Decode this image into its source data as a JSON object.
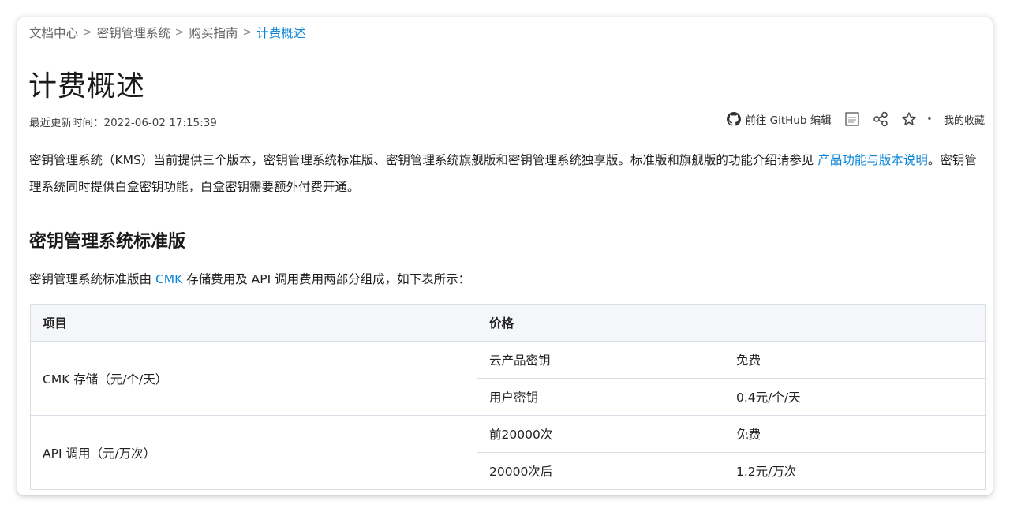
{
  "breadcrumb": {
    "items": [
      "文档中心",
      "密钥管理系统",
      "购买指南"
    ],
    "current": "计费概述",
    "separator": ">"
  },
  "page": {
    "title": "计费概述",
    "updated": "最近更新时间：2022-06-02 17:15:39"
  },
  "toolbar": {
    "github_label": "前往 GitHub 编辑",
    "pdf_icon": "pdf-icon",
    "share_icon": "share-icon",
    "star_icon": "star-icon",
    "dot": "•",
    "favorites_label": "我的收藏"
  },
  "intro": {
    "text1": "密钥管理系统（KMS）当前提供三个版本，密钥管理系统标准版、密钥管理系统旗舰版和密钥管理系统独享版。标准版和旗舰版的功能介绍请参见 ",
    "link": "产品功能与版本说明",
    "text2": "。密钥管理系统同时提供白盒密钥功能，白盒密钥需要额外付费开通。"
  },
  "section": {
    "heading": "密钥管理系统标准版",
    "desc_pre": "密钥管理系统标准版由 ",
    "desc_link": "CMK",
    "desc_post": " 存储费用及 API 调用费用两部分组成，如下表所示："
  },
  "table": {
    "headers": [
      "项目",
      "价格"
    ],
    "rows": [
      {
        "item": "CMK 存储（元/个/天）",
        "sub": [
          [
            "云产品密钥",
            "免费"
          ],
          [
            "用户密钥",
            "0.4元/个/天"
          ]
        ]
      },
      {
        "item": "API 调用（元/万次）",
        "sub": [
          [
            "前20000次",
            "免费"
          ],
          [
            "20000次后",
            "1.2元/万次"
          ]
        ]
      }
    ]
  },
  "colors": {
    "link": "#0a84d8",
    "header_bg": "#f4f6f9",
    "border": "#d9dee6"
  }
}
